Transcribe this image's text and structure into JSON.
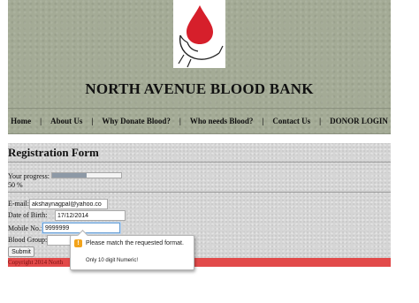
{
  "header": {
    "site_title": "NORTH AVENUE BLOOD BANK",
    "logo_icon": "blood-drop-hand-icon",
    "nav": [
      "Home",
      "About Us",
      "Why Donate Blood?",
      "Who needs Blood?",
      "Contact Us",
      "DONOR LOGIN"
    ]
  },
  "form": {
    "title": "Registration Form",
    "progress_label": "Your progress:",
    "progress_value": 0.5,
    "progress_text": "50 %",
    "email_label": "E-mail:",
    "email_value": "akshaynagpal@yahoo.co",
    "dob_label": "Date of Birth:",
    "dob_value": "17/12/2014",
    "mobile_label": "Mobile No.:",
    "mobile_value": "9999999",
    "blood_group_label": "Blood Group:",
    "submit_label": "Submit"
  },
  "validation_tooltip": {
    "icon": "warning-icon",
    "message": "Please match the requested format.",
    "detail": "Only 10 digit Numeric!"
  },
  "footer": {
    "copyright": "Copyright 2014 North"
  },
  "colors": {
    "header_bg": "#a4ab96",
    "content_bg": "#d5d5d5",
    "footer_bg": "#e24a4a",
    "progress_fill": "#8d99a6",
    "logo_drop": "#d61f2b",
    "warning": "#f2a31b"
  }
}
